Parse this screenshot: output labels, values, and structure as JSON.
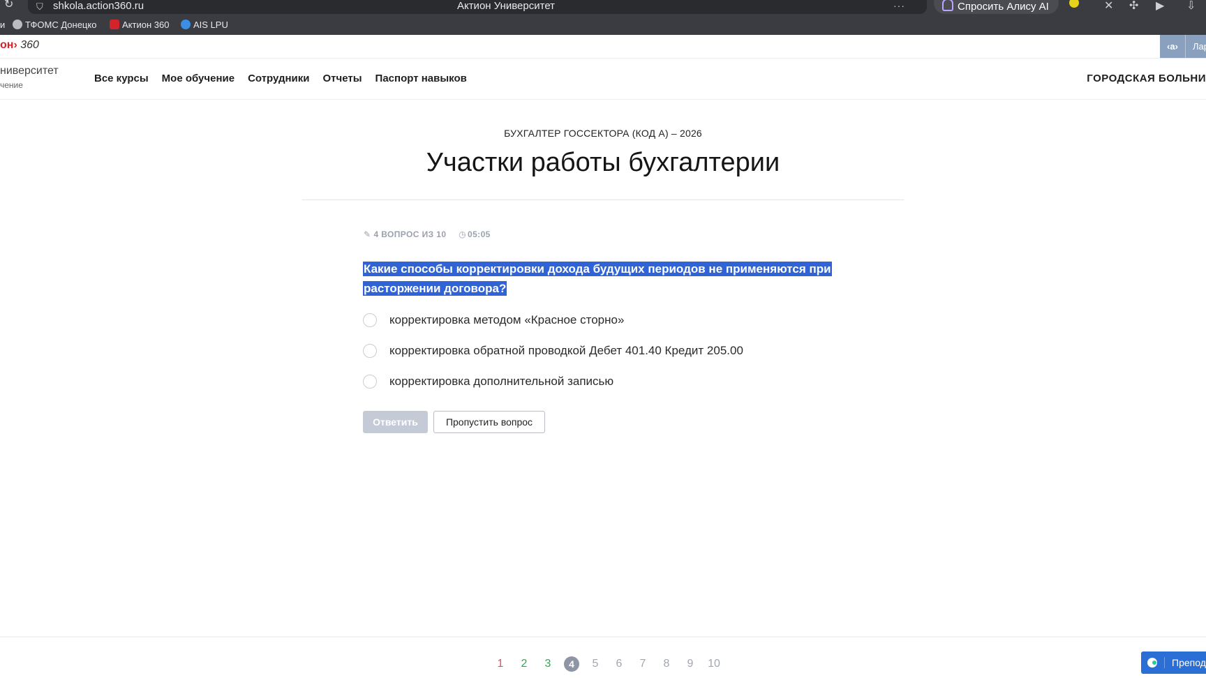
{
  "browser": {
    "url": "shkola.action360.ru",
    "tab_title": "Актион Университет",
    "alice_label": "Спросить Алису AI",
    "bookmarks": [
      "и",
      "ТФОМС Донецко",
      "Актион 360",
      "AIS LPU"
    ]
  },
  "site_strip": {
    "logo_red": "он›",
    "logo_rest": " 360",
    "a_icon": "‹a›",
    "user_short": "Лар"
  },
  "header": {
    "brand_title": "ниверситет",
    "brand_sub": "чение",
    "nav": [
      "Все курсы",
      "Мое обучение",
      "Сотрудники",
      "Отчеты",
      "Паспорт навыков"
    ],
    "org_name": "ГОРОДСКАЯ БОЛЬНИ"
  },
  "main": {
    "course_name": "БУХГАЛТЕР ГОССЕКТОРА (КОД А) – 2026",
    "lesson_title": "Участки работы бухгалтерии",
    "progress_label": "4 ВОПРОС ИЗ 10",
    "timer": "05:05",
    "question_line1": "Какие способы корректировки дохода будущих периодов не применяются при",
    "question_line2": "расторжении договора?",
    "options": [
      "корректировка методом «Красное сторно»",
      "корректировка обратной проводкой Дебет 401.40 Кредит 205.00",
      "корректировка дополнительной записью"
    ],
    "answer_button": "Ответить",
    "skip_button": "Пропустить вопрос"
  },
  "pager": {
    "pages": [
      "1",
      "2",
      "3",
      "4",
      "5",
      "6",
      "7",
      "8",
      "9",
      "10"
    ],
    "current": 4
  },
  "chat": {
    "label": "Препод"
  },
  "colors": {
    "highlight": "#2f63d6",
    "wrong": "#e0525b",
    "right": "#2fa84f",
    "chat": "#2b6fd6"
  }
}
